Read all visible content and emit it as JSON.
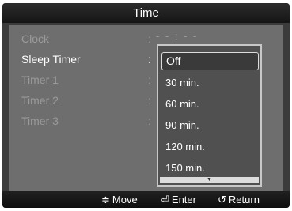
{
  "header": {
    "title": "Time"
  },
  "menu": {
    "items": [
      {
        "label": "Clock",
        "separator": ":"
      },
      {
        "label": "Sleep Timer",
        "separator": ":"
      },
      {
        "label": "Timer 1",
        "separator": ":"
      },
      {
        "label": "Timer 2",
        "separator": ":"
      },
      {
        "label": "Timer 3",
        "separator": ":"
      }
    ],
    "selected_index": 1,
    "clock_value": "- - : - -"
  },
  "dropdown": {
    "options": [
      "Off",
      "30 min.",
      "60 min.",
      "90 min.",
      "120 min.",
      "150 min."
    ],
    "selected": "Off",
    "scroll_glyph": "▼"
  },
  "footer": {
    "move": {
      "icon": "≑",
      "label": "Move"
    },
    "enter": {
      "icon": "⏎",
      "label": "Enter"
    },
    "return": {
      "icon": "↺",
      "label": "Return"
    }
  }
}
